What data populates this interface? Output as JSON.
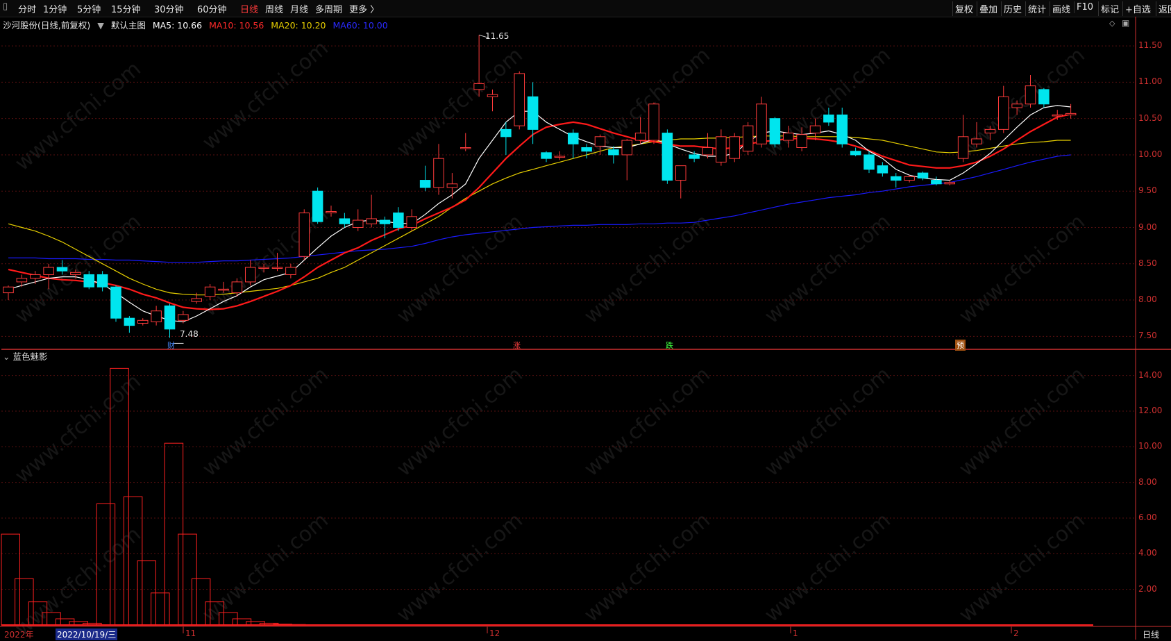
{
  "toolbar": {
    "periods": [
      "分时",
      "1分钟",
      "5分钟",
      "15分钟",
      "30分钟",
      "60分钟",
      "日线",
      "周线",
      "月线",
      "多周期",
      "更多 〉"
    ],
    "active_period": "日线",
    "right_buttons": [
      "复权",
      "叠加",
      "历史",
      "统计",
      "画线",
      "F10",
      "标记",
      "+自选",
      "返回"
    ]
  },
  "legend": {
    "stock": "沙河股份(日线,前复权)",
    "chart_name": "默认主图",
    "ma5": "MA5: 10.66",
    "ma10": "MA10: 10.56",
    "ma20": "MA20: 10.20",
    "ma60": "MA60: 10.00"
  },
  "colors": {
    "up": "#ff3b3b",
    "down": "#00e5ee",
    "ma5": "#ffffff",
    "ma10": "#ff1a1a",
    "ma20": "#e8d000",
    "ma60": "#1a1aff",
    "axis": "#d03030"
  },
  "indicator": {
    "name": "蓝色魅影"
  },
  "annotations": {
    "high_label": "11.65",
    "low_label": "7.48",
    "event_marks": [
      "财",
      "涨",
      "跌",
      "预"
    ]
  },
  "price_axis": [
    "11.50",
    "11.00",
    "10.50",
    "10.00",
    "9.50",
    "9.00",
    "8.50",
    "8.00",
    "7.50"
  ],
  "indicator_axis": [
    "14.00",
    "12.00",
    "10.00",
    "8.00",
    "6.00",
    "4.00",
    "2.00"
  ],
  "date_axis": [
    "2022年",
    "2022/10/19/三",
    "11",
    "12",
    "1",
    "2"
  ],
  "status": {
    "period": "日线"
  },
  "watermark": "www.cfchi.com",
  "chart_data": [
    {
      "type": "candlestick",
      "title": "沙河股份(日线,前复权)",
      "ylim": [
        7.35,
        11.75
      ],
      "candles": [
        [
          8.1,
          8.18,
          8.0,
          8.2
        ],
        [
          8.25,
          8.3,
          8.18,
          8.35
        ],
        [
          8.3,
          8.35,
          8.22,
          8.4
        ],
        [
          8.35,
          8.45,
          8.15,
          8.5
        ],
        [
          8.45,
          8.4,
          8.35,
          8.55
        ],
        [
          8.35,
          8.38,
          8.3,
          8.42
        ],
        [
          8.35,
          8.18,
          8.15,
          8.4
        ],
        [
          8.35,
          8.18,
          8.12,
          8.4
        ],
        [
          8.18,
          7.75,
          7.7,
          8.2
        ],
        [
          7.75,
          7.65,
          7.55,
          7.78
        ],
        [
          7.68,
          7.72,
          7.65,
          7.75
        ],
        [
          7.7,
          7.85,
          7.65,
          7.92
        ],
        [
          7.92,
          7.6,
          7.48,
          7.95
        ],
        [
          7.72,
          7.8,
          7.68,
          7.85
        ],
        [
          7.98,
          8.02,
          7.95,
          8.1
        ],
        [
          8.05,
          8.18,
          8.0,
          8.22
        ],
        [
          8.15,
          8.15,
          8.1,
          8.25
        ],
        [
          8.1,
          8.25,
          8.05,
          8.3
        ],
        [
          8.25,
          8.45,
          8.2,
          8.55
        ],
        [
          8.45,
          8.45,
          8.38,
          8.5
        ],
        [
          8.45,
          8.45,
          8.4,
          8.65
        ],
        [
          8.35,
          8.45,
          8.3,
          8.5
        ],
        [
          8.6,
          9.2,
          8.55,
          9.25
        ],
        [
          9.5,
          9.08,
          9.05,
          9.55
        ],
        [
          9.2,
          9.22,
          9.15,
          9.3
        ],
        [
          9.12,
          9.05,
          9.0,
          9.2
        ],
        [
          9.0,
          9.1,
          8.95,
          9.25
        ],
        [
          9.05,
          9.12,
          9.0,
          9.45
        ],
        [
          9.1,
          9.05,
          8.85,
          9.15
        ],
        [
          9.2,
          9.0,
          8.95,
          9.28
        ],
        [
          9.0,
          9.15,
          8.95,
          9.25
        ],
        [
          9.65,
          9.55,
          9.5,
          9.85
        ],
        [
          9.55,
          9.95,
          9.45,
          10.15
        ],
        [
          9.55,
          9.6,
          9.4,
          9.75
        ],
        [
          10.1,
          10.1,
          10.05,
          10.3
        ],
        [
          10.9,
          10.98,
          10.8,
          11.65
        ],
        [
          10.8,
          10.83,
          10.6,
          10.9
        ],
        [
          10.35,
          10.25,
          10.0,
          10.45
        ],
        [
          10.4,
          11.12,
          10.35,
          11.15
        ],
        [
          10.8,
          10.35,
          10.15,
          11.0
        ],
        [
          10.03,
          9.95,
          9.9,
          10.05
        ],
        [
          9.98,
          9.98,
          9.93,
          10.05
        ],
        [
          10.3,
          10.15,
          9.95,
          10.35
        ],
        [
          10.1,
          10.05,
          9.95,
          10.15
        ],
        [
          10.12,
          10.25,
          10.0,
          10.28
        ],
        [
          10.07,
          10.0,
          9.88,
          10.12
        ],
        [
          10.0,
          10.2,
          9.65,
          10.22
        ],
        [
          10.2,
          10.3,
          10.15,
          10.52
        ],
        [
          10.2,
          10.7,
          10.15,
          10.72
        ],
        [
          10.3,
          9.65,
          9.6,
          10.35
        ],
        [
          9.65,
          9.85,
          9.4,
          9.85
        ],
        [
          10.0,
          9.95,
          9.9,
          10.05
        ],
        [
          10.0,
          10.1,
          9.95,
          10.3
        ],
        [
          9.9,
          10.25,
          9.85,
          10.35
        ],
        [
          9.95,
          10.25,
          9.9,
          10.3
        ],
        [
          10.05,
          10.4,
          10.0,
          10.45
        ],
        [
          10.15,
          10.7,
          10.1,
          10.8
        ],
        [
          10.5,
          10.15,
          10.1,
          10.52
        ],
        [
          10.2,
          10.3,
          10.1,
          10.4
        ],
        [
          10.1,
          10.28,
          10.05,
          10.38
        ],
        [
          10.3,
          10.4,
          10.2,
          10.5
        ],
        [
          10.55,
          10.45,
          10.4,
          10.65
        ],
        [
          10.55,
          10.15,
          10.1,
          10.65
        ],
        [
          10.05,
          10.0,
          9.98,
          10.1
        ],
        [
          10.0,
          9.8,
          9.75,
          10.05
        ],
        [
          9.85,
          9.75,
          9.7,
          9.9
        ],
        [
          9.7,
          9.65,
          9.55,
          9.75
        ],
        [
          9.65,
          9.7,
          9.62,
          9.72
        ],
        [
          9.75,
          9.68,
          9.65,
          9.77
        ],
        [
          9.65,
          9.6,
          9.58,
          9.7
        ],
        [
          9.6,
          9.62,
          9.58,
          9.65
        ],
        [
          9.95,
          10.25,
          9.9,
          10.55
        ],
        [
          10.15,
          10.22,
          10.1,
          10.45
        ],
        [
          10.3,
          10.35,
          10.2,
          10.4
        ],
        [
          10.35,
          10.8,
          10.3,
          10.95
        ],
        [
          10.65,
          10.7,
          10.55,
          10.75
        ],
        [
          10.7,
          10.95,
          10.65,
          11.1
        ],
        [
          10.9,
          10.7,
          10.65,
          10.92
        ],
        [
          10.55,
          10.55,
          10.48,
          10.62
        ],
        [
          10.55,
          10.57,
          10.5,
          10.7
        ]
      ],
      "series": [
        {
          "name": "MA5",
          "values": [
            8.15,
            8.2,
            8.25,
            8.3,
            8.32,
            8.32,
            8.28,
            8.22,
            8.1,
            7.97,
            7.85,
            7.78,
            7.72,
            7.7,
            7.78,
            7.88,
            7.98,
            8.06,
            8.18,
            8.28,
            8.33,
            8.38,
            8.55,
            8.72,
            8.88,
            9.0,
            9.08,
            9.1,
            9.08,
            9.06,
            9.05,
            9.18,
            9.33,
            9.45,
            9.6,
            9.95,
            10.2,
            10.45,
            10.6,
            10.6,
            10.45,
            10.35,
            10.25,
            10.18,
            10.12,
            10.1,
            10.1,
            10.15,
            10.22,
            10.15,
            10.08,
            10.02,
            9.98,
            9.98,
            10.02,
            10.18,
            10.3,
            10.33,
            10.3,
            10.28,
            10.3,
            10.33,
            10.28,
            10.2,
            10.05,
            9.95,
            9.8,
            9.72,
            9.68,
            9.66,
            9.65,
            9.75,
            9.88,
            10.02,
            10.2,
            10.38,
            10.55,
            10.65,
            10.68,
            10.66
          ]
        },
        {
          "name": "MA10",
          "values": [
            8.42,
            8.38,
            8.34,
            8.3,
            8.28,
            8.27,
            8.25,
            8.24,
            8.2,
            8.15,
            8.08,
            8.03,
            7.96,
            7.9,
            7.88,
            7.87,
            7.88,
            7.92,
            7.98,
            8.05,
            8.12,
            8.2,
            8.32,
            8.45,
            8.55,
            8.65,
            8.72,
            8.82,
            8.9,
            8.98,
            9.03,
            9.12,
            9.2,
            9.28,
            9.38,
            9.55,
            9.75,
            9.95,
            10.12,
            10.28,
            10.38,
            10.42,
            10.45,
            10.42,
            10.36,
            10.3,
            10.25,
            10.2,
            10.18,
            10.15,
            10.12,
            10.12,
            10.1,
            10.08,
            10.1,
            10.15,
            10.18,
            10.2,
            10.22,
            10.23,
            10.22,
            10.2,
            10.17,
            10.12,
            10.06,
            9.98,
            9.92,
            9.86,
            9.84,
            9.82,
            9.82,
            9.85,
            9.9,
            9.98,
            10.08,
            10.2,
            10.32,
            10.42,
            10.52,
            10.56
          ]
        },
        {
          "name": "MA20",
          "values": [
            9.05,
            9.0,
            8.95,
            8.88,
            8.8,
            8.7,
            8.6,
            8.5,
            8.4,
            8.3,
            8.22,
            8.15,
            8.1,
            8.08,
            8.07,
            8.07,
            8.08,
            8.1,
            8.12,
            8.14,
            8.16,
            8.2,
            8.25,
            8.3,
            8.38,
            8.45,
            8.55,
            8.65,
            8.75,
            8.85,
            8.95,
            9.05,
            9.15,
            9.28,
            9.4,
            9.5,
            9.6,
            9.68,
            9.75,
            9.8,
            9.85,
            9.9,
            9.95,
            10.0,
            10.05,
            10.1,
            10.12,
            10.15,
            10.18,
            10.2,
            10.22,
            10.22,
            10.23,
            10.23,
            10.24,
            10.25,
            10.26,
            10.26,
            10.26,
            10.25,
            10.25,
            10.25,
            10.25,
            10.24,
            10.22,
            10.2,
            10.16,
            10.12,
            10.08,
            10.04,
            10.03,
            10.04,
            10.06,
            10.09,
            10.12,
            10.15,
            10.17,
            10.18,
            10.2,
            10.2
          ]
        },
        {
          "name": "MA60",
          "values": [
            8.58,
            8.58,
            8.58,
            8.57,
            8.57,
            8.57,
            8.56,
            8.56,
            8.55,
            8.55,
            8.54,
            8.53,
            8.52,
            8.52,
            8.52,
            8.53,
            8.54,
            8.54,
            8.55,
            8.56,
            8.57,
            8.58,
            8.6,
            8.62,
            8.64,
            8.66,
            8.68,
            8.69,
            8.7,
            8.72,
            8.74,
            8.78,
            8.83,
            8.87,
            8.9,
            8.92,
            8.94,
            8.96,
            8.98,
            9.0,
            9.01,
            9.02,
            9.03,
            9.03,
            9.04,
            9.04,
            9.04,
            9.05,
            9.05,
            9.06,
            9.06,
            9.07,
            9.1,
            9.13,
            9.16,
            9.2,
            9.24,
            9.28,
            9.32,
            9.35,
            9.38,
            9.41,
            9.43,
            9.45,
            9.48,
            9.5,
            9.53,
            9.56,
            9.58,
            9.6,
            9.62,
            9.66,
            9.7,
            9.75,
            9.8,
            9.85,
            9.9,
            9.94,
            9.98,
            10.0
          ]
        }
      ]
    },
    {
      "type": "bar",
      "title": "蓝色魅影",
      "ylim": [
        0,
        15
      ],
      "values": [
        5.1,
        2.6,
        1.3,
        0.7,
        0.35,
        0.2,
        0.1,
        6.8,
        14.4,
        7.2,
        3.6,
        1.8,
        10.2,
        5.1,
        2.6,
        1.3,
        0.7,
        0.35,
        0.2,
        0.1,
        0.05,
        0.03,
        0.02,
        0.01,
        0.01,
        0.01
      ]
    }
  ]
}
